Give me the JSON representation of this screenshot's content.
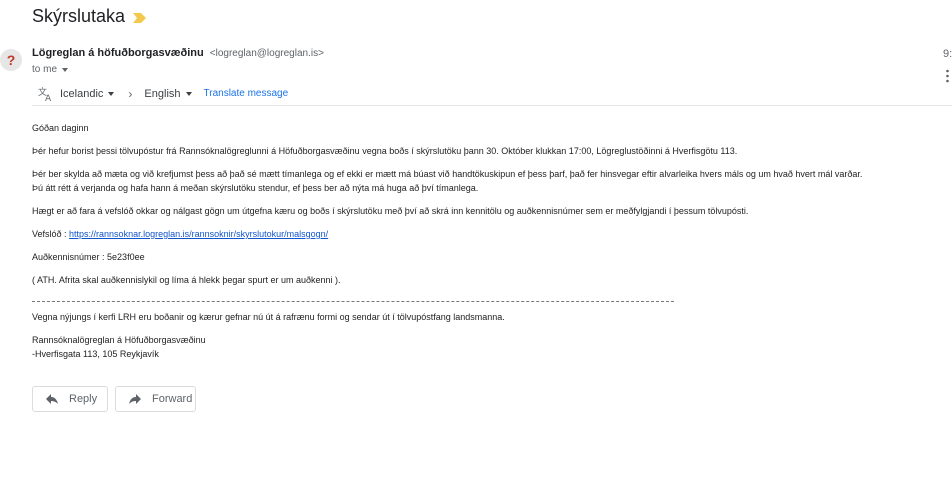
{
  "email": {
    "subject": "Skýrslutaka",
    "importance_icon": "importance-marker-icon",
    "avatar_char": "?",
    "sender_name": "Lögreglan á höfuðborgasvæðinu",
    "sender_email": "<logreglan@logreglan.is>",
    "time_partial": "9:",
    "to_label": "to me"
  },
  "translate": {
    "icon": "translate-icon",
    "source_lang": "Icelandic",
    "target_lang": "English",
    "link": "Translate message"
  },
  "body": {
    "greeting": "Góðan daginn",
    "p1": "Þér hefur borist þessi tölvupóstur frá Rannsóknalögreglunni á Höfuðborgasvæðinu vegna boðs í skýrslutöku þann 30. Október klukkan 17:00, Lögreglustöðinni á Hverfisgötu 113.",
    "p2_line1": "Þér ber skylda að mæta og við krefjumst þess að það sé mætt tímanlega og ef ekki er mætt má búast við handtökuskipun ef þess þarf, það fer hinsvegar eftir alvarleika hvers máls og um hvað hvert mál varðar.",
    "p2_line2": "Þú átt rétt á verjanda og hafa hann á meðan skýrslutöku stendur, ef þess ber að nýta má huga að því tímanlega.",
    "p3": "Hægt er að fara á vefslóð okkar og nálgast gögn um útgefna kæru og boðs í skýrslutöku með því að skrá inn kennitölu og auðkennisnúmer sem er meðfylgjandi í þessum tölvupósti.",
    "url_label": "Vefslóð : ",
    "url": "https://rannsoknar.logreglan.is/rannsoknir/skyrslutokur/malsgogn/",
    "code_line": "Auðkennisnúmer : 5e23f0ee",
    "note": "( ATH. Afrita skal auðkennislykil og líma á hlekk þegar spurt er um auðkenni ).",
    "footer_note": "Vegna nýjungs í kerfi LRH eru boðanir og kærur gefnar nú út á rafrænu formi og sendar út í tölvupóstfang landsmanna.",
    "sig_line1": "Rannsóknalögreglan á Höfuðborgasvæðinu",
    "sig_line2": "-Hverfisgata 113, 105 Reykjavík"
  },
  "actions": {
    "reply_label": "Reply",
    "reply_icon": "reply-arrow-icon",
    "forward_label": "Forward",
    "forward_icon": "forward-arrow-icon"
  },
  "colors": {
    "link": "#1155cc",
    "translate_link": "#1a73e8",
    "importance": "#f2c94c",
    "avatar_mark": "#c0392b"
  }
}
